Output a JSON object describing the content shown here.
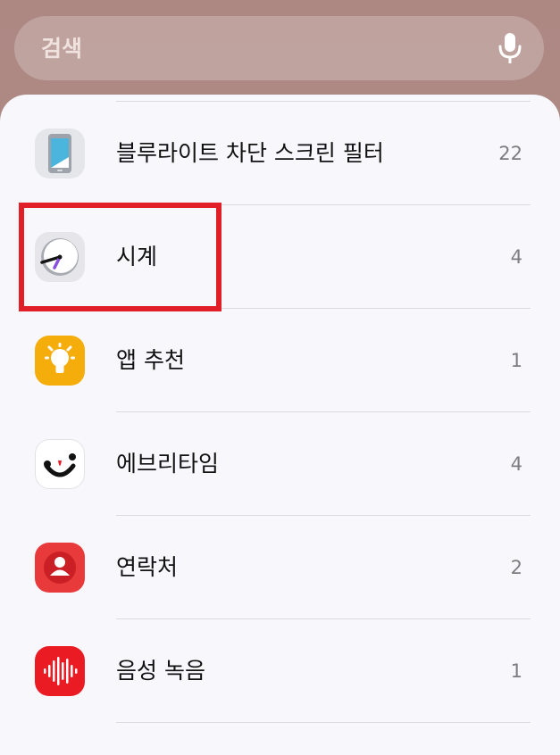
{
  "search": {
    "placeholder": "검색",
    "mic_icon": "microphone-icon"
  },
  "apps": [
    {
      "name": "블루라이트 차단 스크린 필터",
      "count": "22",
      "icon": "phone-screen-filter-icon"
    },
    {
      "name": "시계",
      "count": "4",
      "icon": "clock-icon"
    },
    {
      "name": "앱 추천",
      "count": "1",
      "icon": "lightbulb-icon"
    },
    {
      "name": "에브리타임",
      "count": "4",
      "icon": "everytime-icon"
    },
    {
      "name": "연락처",
      "count": "2",
      "icon": "contacts-icon"
    },
    {
      "name": "음성 녹음",
      "count": "1",
      "icon": "voice-recorder-icon"
    }
  ],
  "highlight": {
    "color": "#e01f26",
    "target": "시계"
  },
  "colors": {
    "background": "#ad8883",
    "panel": "#f8f7fb",
    "divider": "#dcdbe0"
  }
}
